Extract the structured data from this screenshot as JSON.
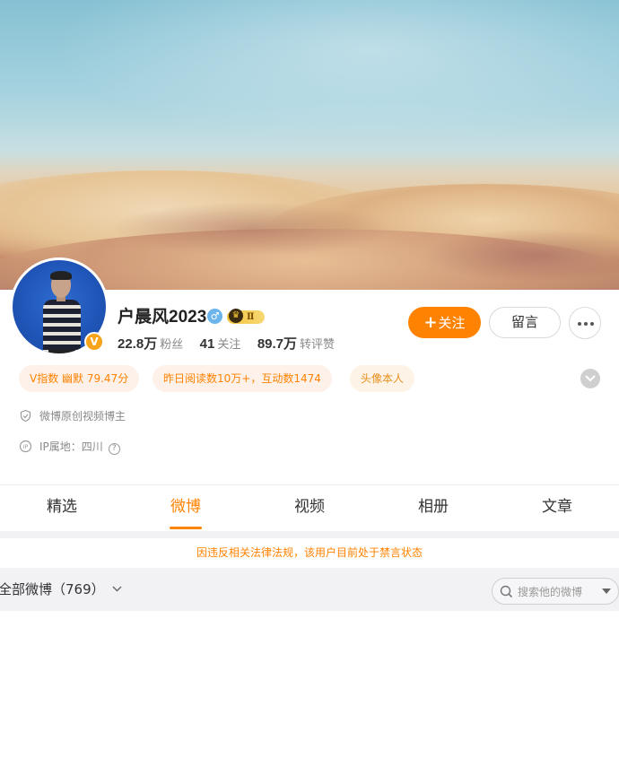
{
  "profile": {
    "name": "户晨风2023",
    "gender_icon": "male-icon",
    "verified_badge": "V",
    "crown_level": "Ⅱ"
  },
  "stats": [
    {
      "num": "22.8万",
      "label": "粉丝"
    },
    {
      "num": "41",
      "label": "关注"
    },
    {
      "num": "89.7万",
      "label": "转评赞"
    }
  ],
  "actions": {
    "follow_plus": "+",
    "follow_label": "关注",
    "message_label": "留言"
  },
  "tags": [
    "V指数 幽默 79.47分",
    "昨日阅读数10万+，互动数1474",
    "头像本人"
  ],
  "info": {
    "role": "微博原创视频博主",
    "ip_label": "IP属地：四川",
    "ip_icon_text": "IP",
    "help_icon_text": "?"
  },
  "tabs": [
    "精选",
    "微博",
    "视频",
    "相册",
    "文章"
  ],
  "active_tab_index": 1,
  "notice": "因违反相关法律法规，该用户目前处于禁言状态",
  "filter": {
    "label": "全部微博（769）"
  },
  "search": {
    "placeholder": "搜索他的微博"
  },
  "colors": {
    "accent": "#ff8200",
    "tag_bg": "#fdf1ea",
    "band": "#f2f2f5"
  }
}
